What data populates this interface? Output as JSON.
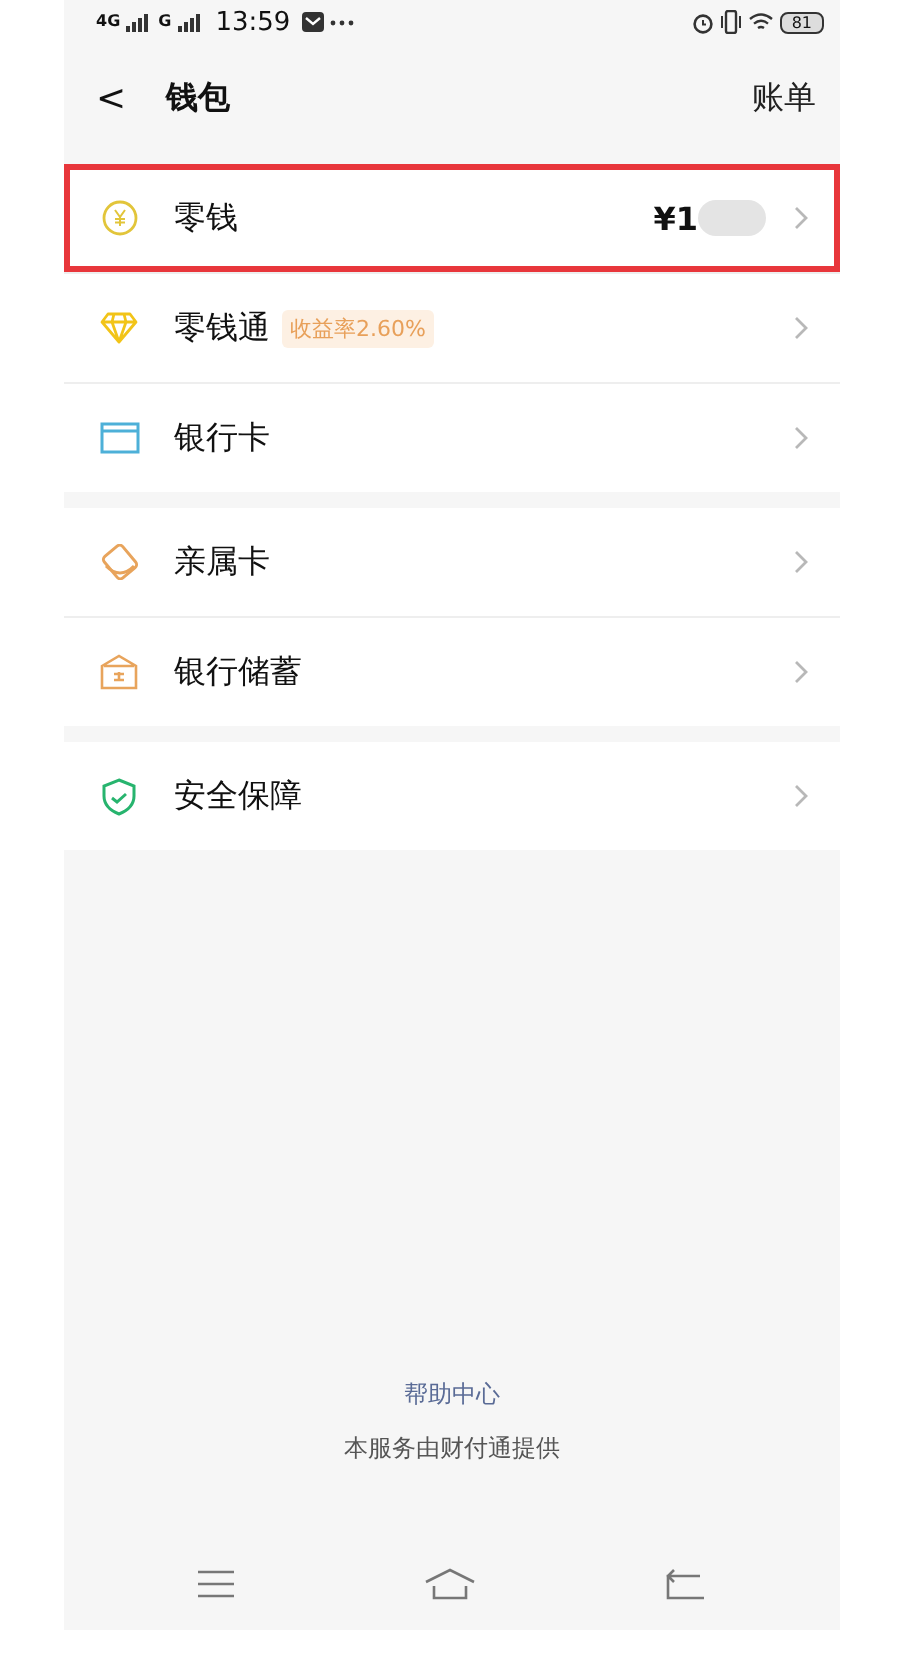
{
  "status_bar": {
    "network_1": "4G",
    "network_2": "G",
    "time": "13:59",
    "battery": "81"
  },
  "header": {
    "back": "<",
    "title": "钱包",
    "action": "账单"
  },
  "groups": [
    {
      "items": [
        {
          "kind": "yen",
          "label": "零钱",
          "amount": "¥1",
          "highlighted": true
        },
        {
          "kind": "diamond",
          "label": "零钱通",
          "badge": "收益率2.60%",
          "highlighted": false
        },
        {
          "kind": "card",
          "label": "银行卡",
          "highlighted": false
        }
      ]
    },
    {
      "items": [
        {
          "kind": "family",
          "label": "亲属卡",
          "highlighted": false
        },
        {
          "kind": "bank",
          "label": "银行储蓄",
          "highlighted": false
        }
      ]
    },
    {
      "items": [
        {
          "kind": "shield",
          "label": "安全保障",
          "highlighted": false
        }
      ]
    }
  ],
  "footer": {
    "link": "帮助中心",
    "note": "本服务由财付通提供"
  }
}
